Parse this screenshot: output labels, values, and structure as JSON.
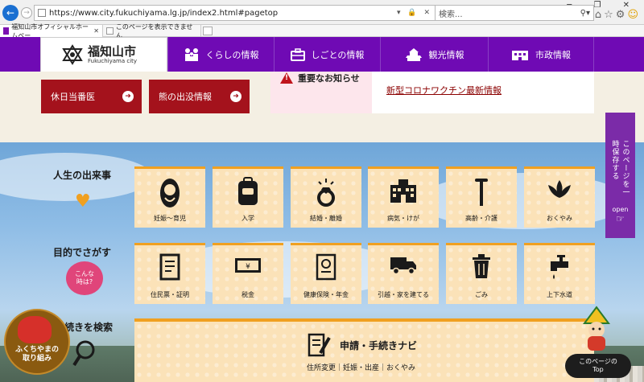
{
  "browser": {
    "url": "https://www.city.fukuchiyama.lg.jp/index2.html#pagetop",
    "search_placeholder": "検索...",
    "tabs": [
      {
        "label": "福知山市オフィシャルホームペー..."
      },
      {
        "label": "このページを表示できません"
      }
    ]
  },
  "header": {
    "logo_jp": "福知山市",
    "logo_en": "Fukuchiyama city",
    "nav": [
      {
        "label": "くらしの情報",
        "icon": "family-icon"
      },
      {
        "label": "しごとの情報",
        "icon": "briefcase-icon"
      },
      {
        "label": "観光情報",
        "icon": "castle-icon"
      },
      {
        "label": "市政情報",
        "icon": "city-hall-icon"
      }
    ]
  },
  "quick_links": {
    "holiday_doctor": "休日当番医",
    "bear_info": "熊の出没情報"
  },
  "notice": {
    "title": "重要なお知らせ",
    "link": "新型コロナワクチン最新情報"
  },
  "life_events": {
    "label": "人生の出来事",
    "items": [
      {
        "label": "妊娠～育児",
        "icon": "baby-icon"
      },
      {
        "label": "入学",
        "icon": "school-bag-icon"
      },
      {
        "label": "結婚・離婚",
        "icon": "ring-icon"
      },
      {
        "label": "病気・けが",
        "icon": "hospital-icon"
      },
      {
        "label": "高齢・介護",
        "icon": "cane-icon"
      },
      {
        "label": "おくやみ",
        "icon": "lotus-icon"
      }
    ]
  },
  "purpose": {
    "label": "目的でさがす",
    "bubble_line1": "こんな",
    "bubble_line2": "時は?",
    "items": [
      {
        "label": "住民票・証明",
        "icon": "document-icon"
      },
      {
        "label": "税金",
        "icon": "money-icon"
      },
      {
        "label": "健康保険・年金",
        "icon": "certificate-icon"
      },
      {
        "label": "引越・家を建てる",
        "icon": "truck-icon"
      },
      {
        "label": "ごみ",
        "icon": "trash-icon"
      },
      {
        "label": "上下水道",
        "icon": "faucet-icon"
      }
    ]
  },
  "procedures": {
    "search_label": "続きを検索",
    "title": "申請・手続きナビ",
    "sub": "住所変更｜妊娠・出産｜おくやみ"
  },
  "side_tab": {
    "text": "このページを一時保存する",
    "open": "open"
  },
  "fukuchiyama_btn": {
    "line1": "ふくちやまの",
    "line2": "取り組み"
  },
  "top_btn": {
    "line1": "このページの",
    "line2": "Top"
  },
  "colors": {
    "brand_purple": "#6f0ab4",
    "red_button": "#a4121c",
    "tile_bg": "#fbe2b8",
    "tile_accent": "#f0a020"
  }
}
